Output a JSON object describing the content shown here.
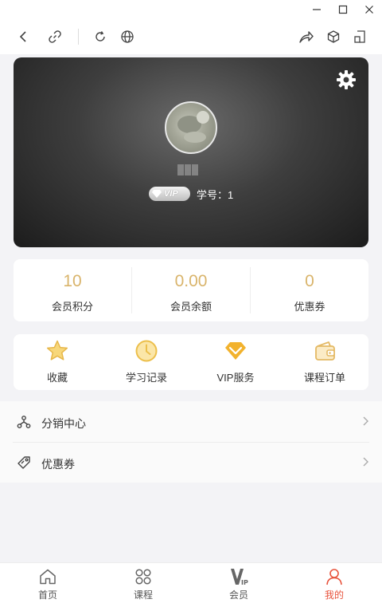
{
  "window": {
    "controls": [
      "minimize-icon",
      "maximize-icon",
      "close-icon"
    ]
  },
  "toolbar": {
    "icons": [
      "back-icon",
      "link-icon",
      "refresh-icon",
      "globe-icon",
      "share-icon",
      "cube-icon",
      "window-icon"
    ]
  },
  "profile": {
    "vip_badge": "VIP",
    "student_id": "学号：1",
    "settings_icon": "gear-icon"
  },
  "stats": [
    {
      "value": "10",
      "label": "会员积分"
    },
    {
      "value": "0.00",
      "label": "会员余额"
    },
    {
      "value": "0",
      "label": "优惠券"
    }
  ],
  "actions": [
    {
      "label": "收藏",
      "icon": "star-icon"
    },
    {
      "label": "学习记录",
      "icon": "clock-icon"
    },
    {
      "label": "VIP服务",
      "icon": "diamond-icon"
    },
    {
      "label": "课程订单",
      "icon": "wallet-icon"
    }
  ],
  "menu": [
    {
      "label": "分销中心",
      "icon": "network-icon"
    },
    {
      "label": "优惠券",
      "icon": "tag-icon"
    }
  ],
  "tabs": [
    {
      "label": "首页",
      "icon": "home-icon"
    },
    {
      "label": "课程",
      "icon": "grid-icon"
    },
    {
      "label": "会员",
      "icon": "vip-icon"
    },
    {
      "label": "我的",
      "icon": "user-icon",
      "active": true
    }
  ],
  "colors": {
    "accent_gold": "#d9b46b",
    "active_tab": "#e8533c",
    "background": "#f3f3f6"
  }
}
